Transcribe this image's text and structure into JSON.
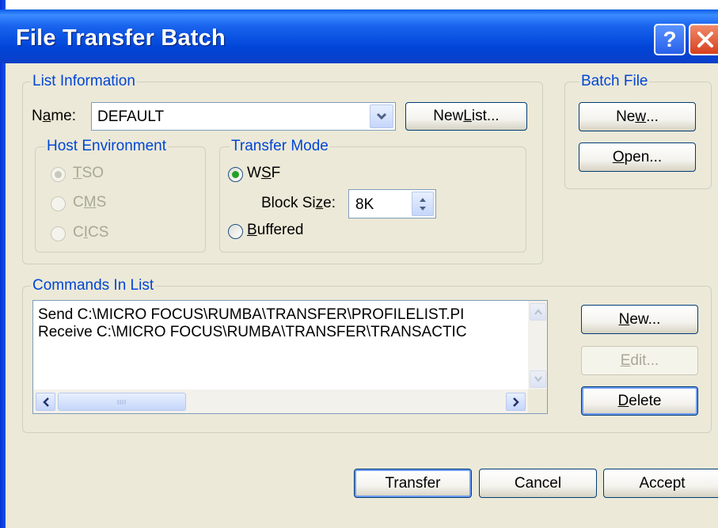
{
  "window": {
    "title": "File Transfer Batch"
  },
  "list_information": {
    "group_label": "List Information",
    "name_label_pre": "N",
    "name_label_acc": "a",
    "name_label_post": "me:",
    "name_value": "DEFAULT",
    "new_list_pre": "New ",
    "new_list_acc": "L",
    "new_list_post": "ist..."
  },
  "host_environment": {
    "group_label": "Host Environment",
    "options": [
      {
        "acc": "T",
        "rest": "SO",
        "selected": true
      },
      {
        "pre": "C",
        "acc": "M",
        "rest": "S",
        "selected": false
      },
      {
        "pre": "C",
        "acc": "I",
        "rest": "CS",
        "selected": false
      }
    ]
  },
  "transfer_mode": {
    "group_label": "Transfer Mode",
    "wsf_pre": "W",
    "wsf_acc": "S",
    "wsf_post": "F",
    "block_size_pre": "Block Si",
    "block_size_acc": "z",
    "block_size_post": "e:",
    "block_size_value": "8K",
    "buffered_acc": "B",
    "buffered_post": "uffered"
  },
  "batch_file": {
    "group_label": "Batch File",
    "new_pre": "Ne",
    "new_acc": "w",
    "new_post": "...",
    "open_acc": "O",
    "open_post": "pen..."
  },
  "commands": {
    "group_label": "Commands In List",
    "items": [
      "Send C:\\MICRO FOCUS\\RUMBA\\TRANSFER\\PROFILELIST.PI",
      "Receive C:\\MICRO FOCUS\\RUMBA\\TRANSFER\\TRANSACTIC"
    ],
    "new_acc": "N",
    "new_post": "ew...",
    "edit_acc": "E",
    "edit_post": "dit...",
    "delete_acc": "D",
    "delete_post": "elete"
  },
  "footer": {
    "transfer": "Transfer",
    "cancel": "Cancel",
    "accept": "Accept"
  },
  "icons": {
    "help": "question-mark-icon",
    "close": "close-x-icon"
  }
}
